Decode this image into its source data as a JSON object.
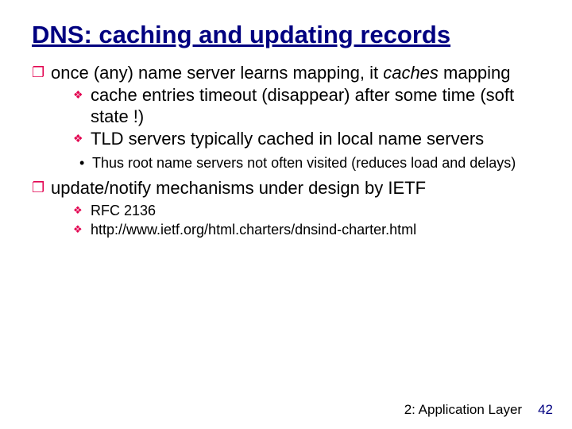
{
  "title": "DNS: caching and updating records",
  "b1": {
    "line1a": "once (any) name server learns mapping, it ",
    "line1b": "caches",
    "line2": "mapping",
    "sub1": "cache entries timeout (disappear) after some time (soft state !)",
    "sub2": "TLD servers typically cached in local name servers",
    "subsub": "Thus root name servers not often visited (reduces load and delays)"
  },
  "b2": {
    "line": "update/notify mechanisms under design by IETF",
    "sub1": "RFC 2136",
    "sub2": "http://www.ietf.org/html.charters/dnsind-charter.html"
  },
  "footer": {
    "chapter": "2: Application Layer",
    "page": "42"
  },
  "bullets": {
    "square": "❐",
    "diamond": "❖",
    "dot": "•"
  }
}
